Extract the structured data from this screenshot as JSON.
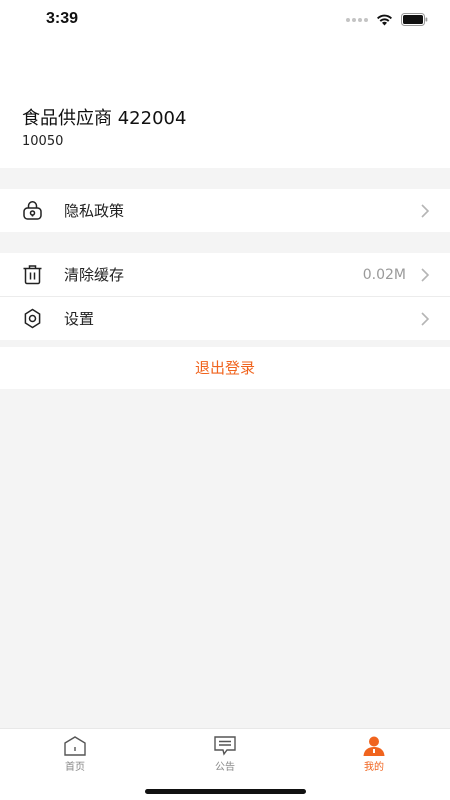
{
  "status_bar": {
    "time": "3:39"
  },
  "profile": {
    "name": "食品供应商 422004",
    "id": "10050"
  },
  "menu": {
    "privacy": {
      "label": "隐私政策"
    },
    "clear_cache": {
      "label": "清除缓存",
      "value": "0.02M"
    },
    "settings": {
      "label": "设置"
    }
  },
  "logout_label": "退出登录",
  "colors": {
    "accent": "#f0641e",
    "background": "#f4f4f4"
  },
  "tabs": [
    {
      "label": "首页",
      "icon": "home-icon",
      "active": false
    },
    {
      "label": "公告",
      "icon": "message-icon",
      "active": false
    },
    {
      "label": "我的",
      "icon": "user-icon",
      "active": true
    }
  ]
}
